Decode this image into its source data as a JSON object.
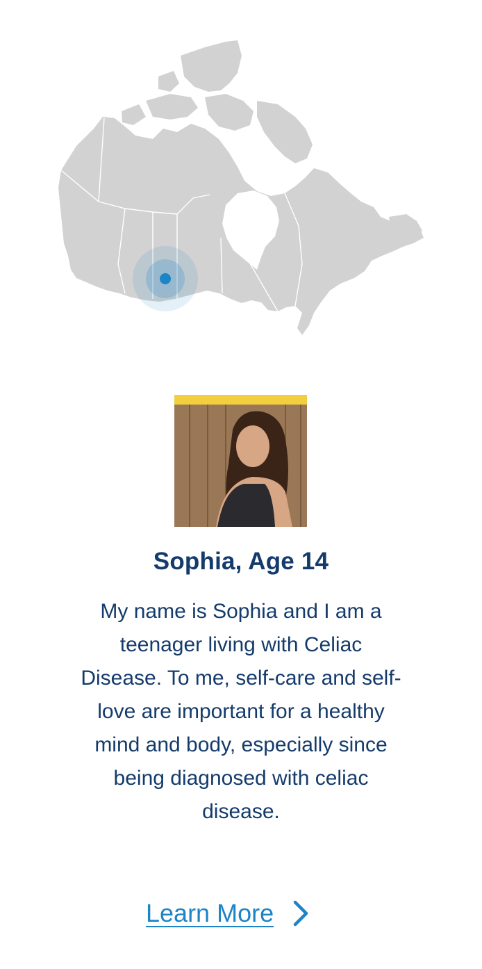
{
  "map": {
    "marker_color": "#1d84c6",
    "land_color": "#d2d2d2",
    "border_color": "#ffffff"
  },
  "profile": {
    "accent_color": "#f1cf3f",
    "name": "Sophia, Age 14",
    "story": "My name is Sophia and I am a teenager living with Celiac Disease. To me, self-care and self-love are important for a healthy mind and body, especially since being diagnosed with celiac disease."
  },
  "cta": {
    "label": "Learn More",
    "icon": "chevron-right-icon",
    "color": "#1d84c6"
  }
}
